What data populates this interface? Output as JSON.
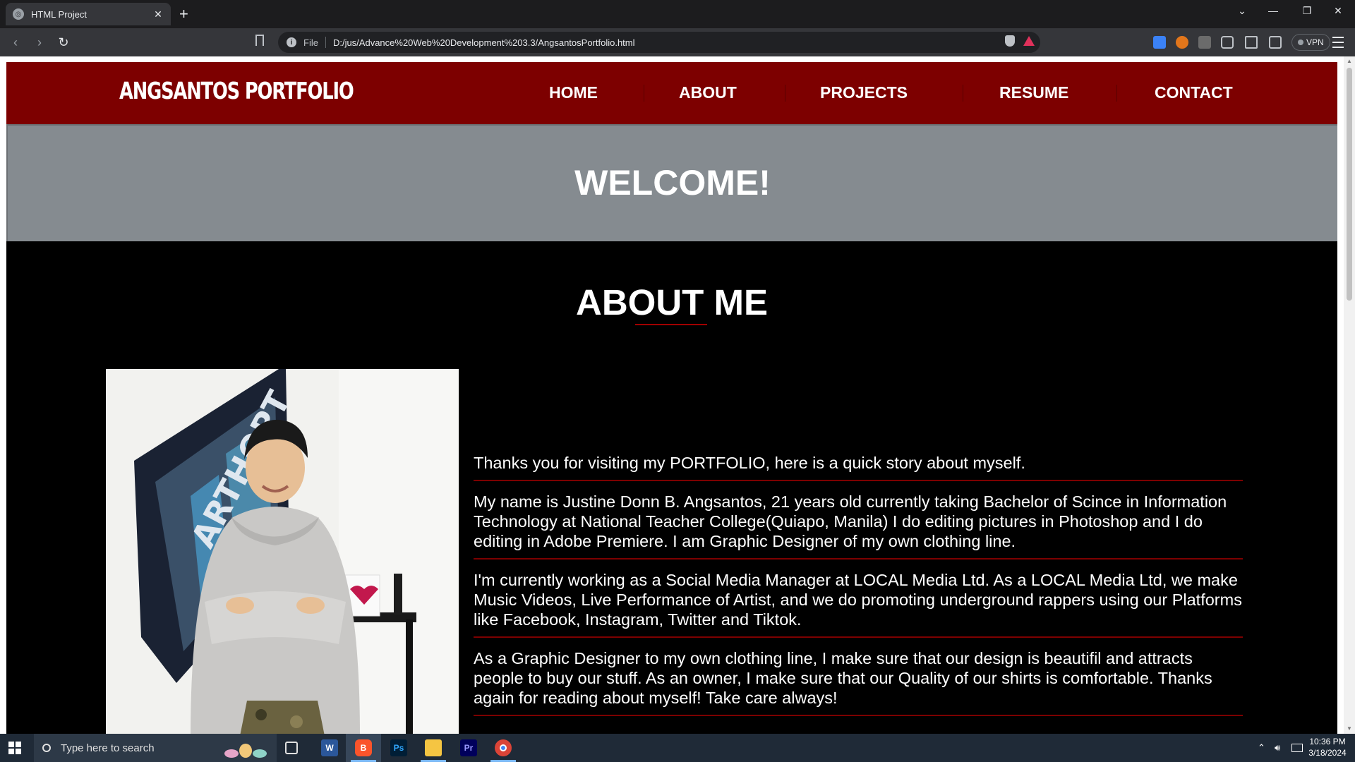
{
  "browser": {
    "tab_title": "HTML Project",
    "new_tab": "+",
    "address_scheme": "File",
    "url": "D:/jus/Advance%20Web%20Development%203.3/AngsantosPortfolio.html",
    "vpn_label": "VPN"
  },
  "site": {
    "logo": "ANGSANTOS PORTFOLIO",
    "nav": [
      "HOME",
      "ABOUT",
      "PROJECTS",
      "RESUME",
      "CONTACT"
    ],
    "welcome": "WELCOME!",
    "about_title": "ABOUT ME",
    "paragraphs": [
      "Thanks you for visiting my PORTFOLIO, here is a quick story about myself.",
      "My name is Justine Donn B. Angsantos, 21 years old currently taking Bachelor of Scince in Information Technology at National Teacher College(Quiapo, Manila) I do editing pictures in Photoshop and I do editing in Adobe Premiere. I am Graphic Designer of my own clothing line.",
      "I'm currently working as a Social Media Manager at LOCAL Media Ltd. As a LOCAL Media Ltd, we make Music Videos, Live Performance of Artist, and we do promoting underground rappers using our Platforms like Facebook, Instagram, Twitter and Tiktok.",
      "As a Graphic Designer to my own clothing line, I make sure that our design is beautifil and attracts people to buy our stuff. As an owner, I make sure that our Quality of our shirts is comfortable. Thanks again for reading about myself! Take care always!"
    ],
    "colors": {
      "header": "#7d0000",
      "welcome_band": "#858b90",
      "about_bg": "#000000",
      "accent_line": "#7d0000"
    }
  },
  "taskbar": {
    "search_placeholder": "Type here to search",
    "apps": [
      "task-view",
      "word",
      "brave",
      "photoshop",
      "file-explorer",
      "premiere",
      "chrome"
    ],
    "time": "10:36 PM",
    "date": "3/18/2024"
  }
}
